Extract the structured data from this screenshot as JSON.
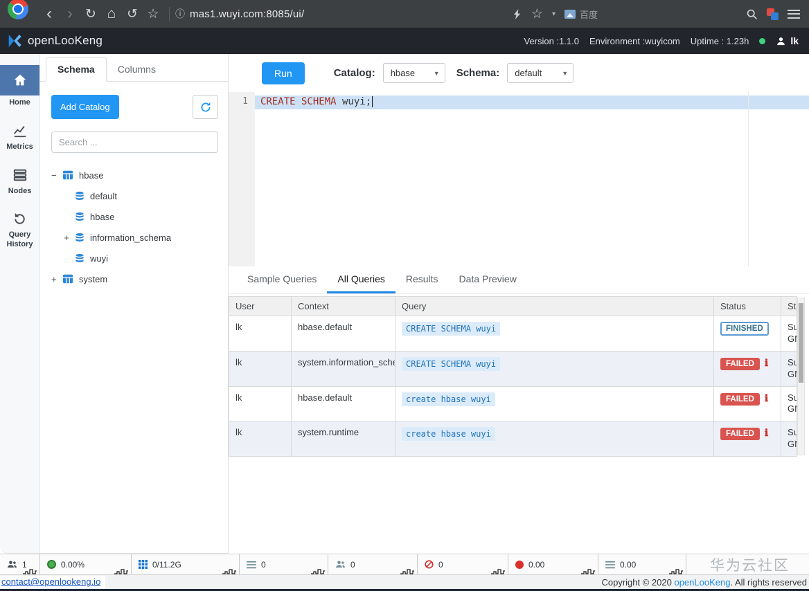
{
  "browser": {
    "url": "mas1.wuyi.com:8085/ui/",
    "baidu_label": "百度"
  },
  "header": {
    "brand": "openLooKeng",
    "version": "Version :1.1.0",
    "environment": "Environment :wuyicom",
    "uptime": "Uptime : 1.23h",
    "user": "lk"
  },
  "sidebar": {
    "items": [
      {
        "label": "Home"
      },
      {
        "label": "Metrics"
      },
      {
        "label": "Nodes"
      },
      {
        "label": "Query History"
      }
    ]
  },
  "schema_panel": {
    "tabs": [
      "Schema",
      "Columns"
    ],
    "add_catalog_label": "Add Catalog",
    "search_placeholder": "Search ...",
    "tree": [
      {
        "expander": "−",
        "label": "hbase"
      },
      {
        "expander": "",
        "label": "default"
      },
      {
        "expander": "",
        "label": "hbase"
      },
      {
        "expander": "+",
        "label": "information_schema"
      },
      {
        "expander": "",
        "label": "wuyi"
      },
      {
        "expander": "+",
        "label": "system"
      }
    ]
  },
  "toolbar": {
    "run_label": "Run",
    "catalog_label": "Catalog:",
    "catalog_value": "hbase",
    "schema_label": "Schema:",
    "schema_value": "default"
  },
  "editor": {
    "line_number": "1",
    "keyword": "CREATE SCHEMA",
    "rest": " wuyi;"
  },
  "query_tabs": [
    "Sample Queries",
    "All Queries",
    "Results",
    "Data Preview"
  ],
  "table": {
    "headers": [
      "User",
      "Context",
      "Query",
      "Status",
      "Sta"
    ],
    "rows": [
      {
        "user": "lk",
        "context": "hbase.default",
        "query": "CREATE SCHEMA wuyi",
        "status": "FINISHED",
        "time1": "Sun",
        "time2": "GM"
      },
      {
        "user": "lk",
        "context": "system.information_schem",
        "query": "CREATE SCHEMA wuyi",
        "status": "FAILED",
        "time1": "Sun",
        "time2": "GM"
      },
      {
        "user": "lk",
        "context": "hbase.default",
        "query": "create hbase wuyi",
        "status": "FAILED",
        "time1": "Sun",
        "time2": "GM"
      },
      {
        "user": "lk",
        "context": "system.runtime",
        "query": "create hbase wuyi",
        "status": "FAILED",
        "time1": "Sun",
        "time2": "GM"
      }
    ]
  },
  "status_bar": {
    "metrics": [
      {
        "value": "1"
      },
      {
        "value": "0.00%"
      },
      {
        "value": "0/11.2G"
      },
      {
        "value": "0"
      },
      {
        "value": "0"
      },
      {
        "value": "0"
      },
      {
        "value": "0.00"
      },
      {
        "value": "0.00"
      }
    ],
    "watermark": "华为云社区"
  },
  "footer": {
    "contact": "contact@openlookeng.io",
    "copyright_prefix": "Copyright © 2020 ",
    "copyright_brand": "openLooKeng",
    "copyright_suffix": ". All rights reserved"
  }
}
